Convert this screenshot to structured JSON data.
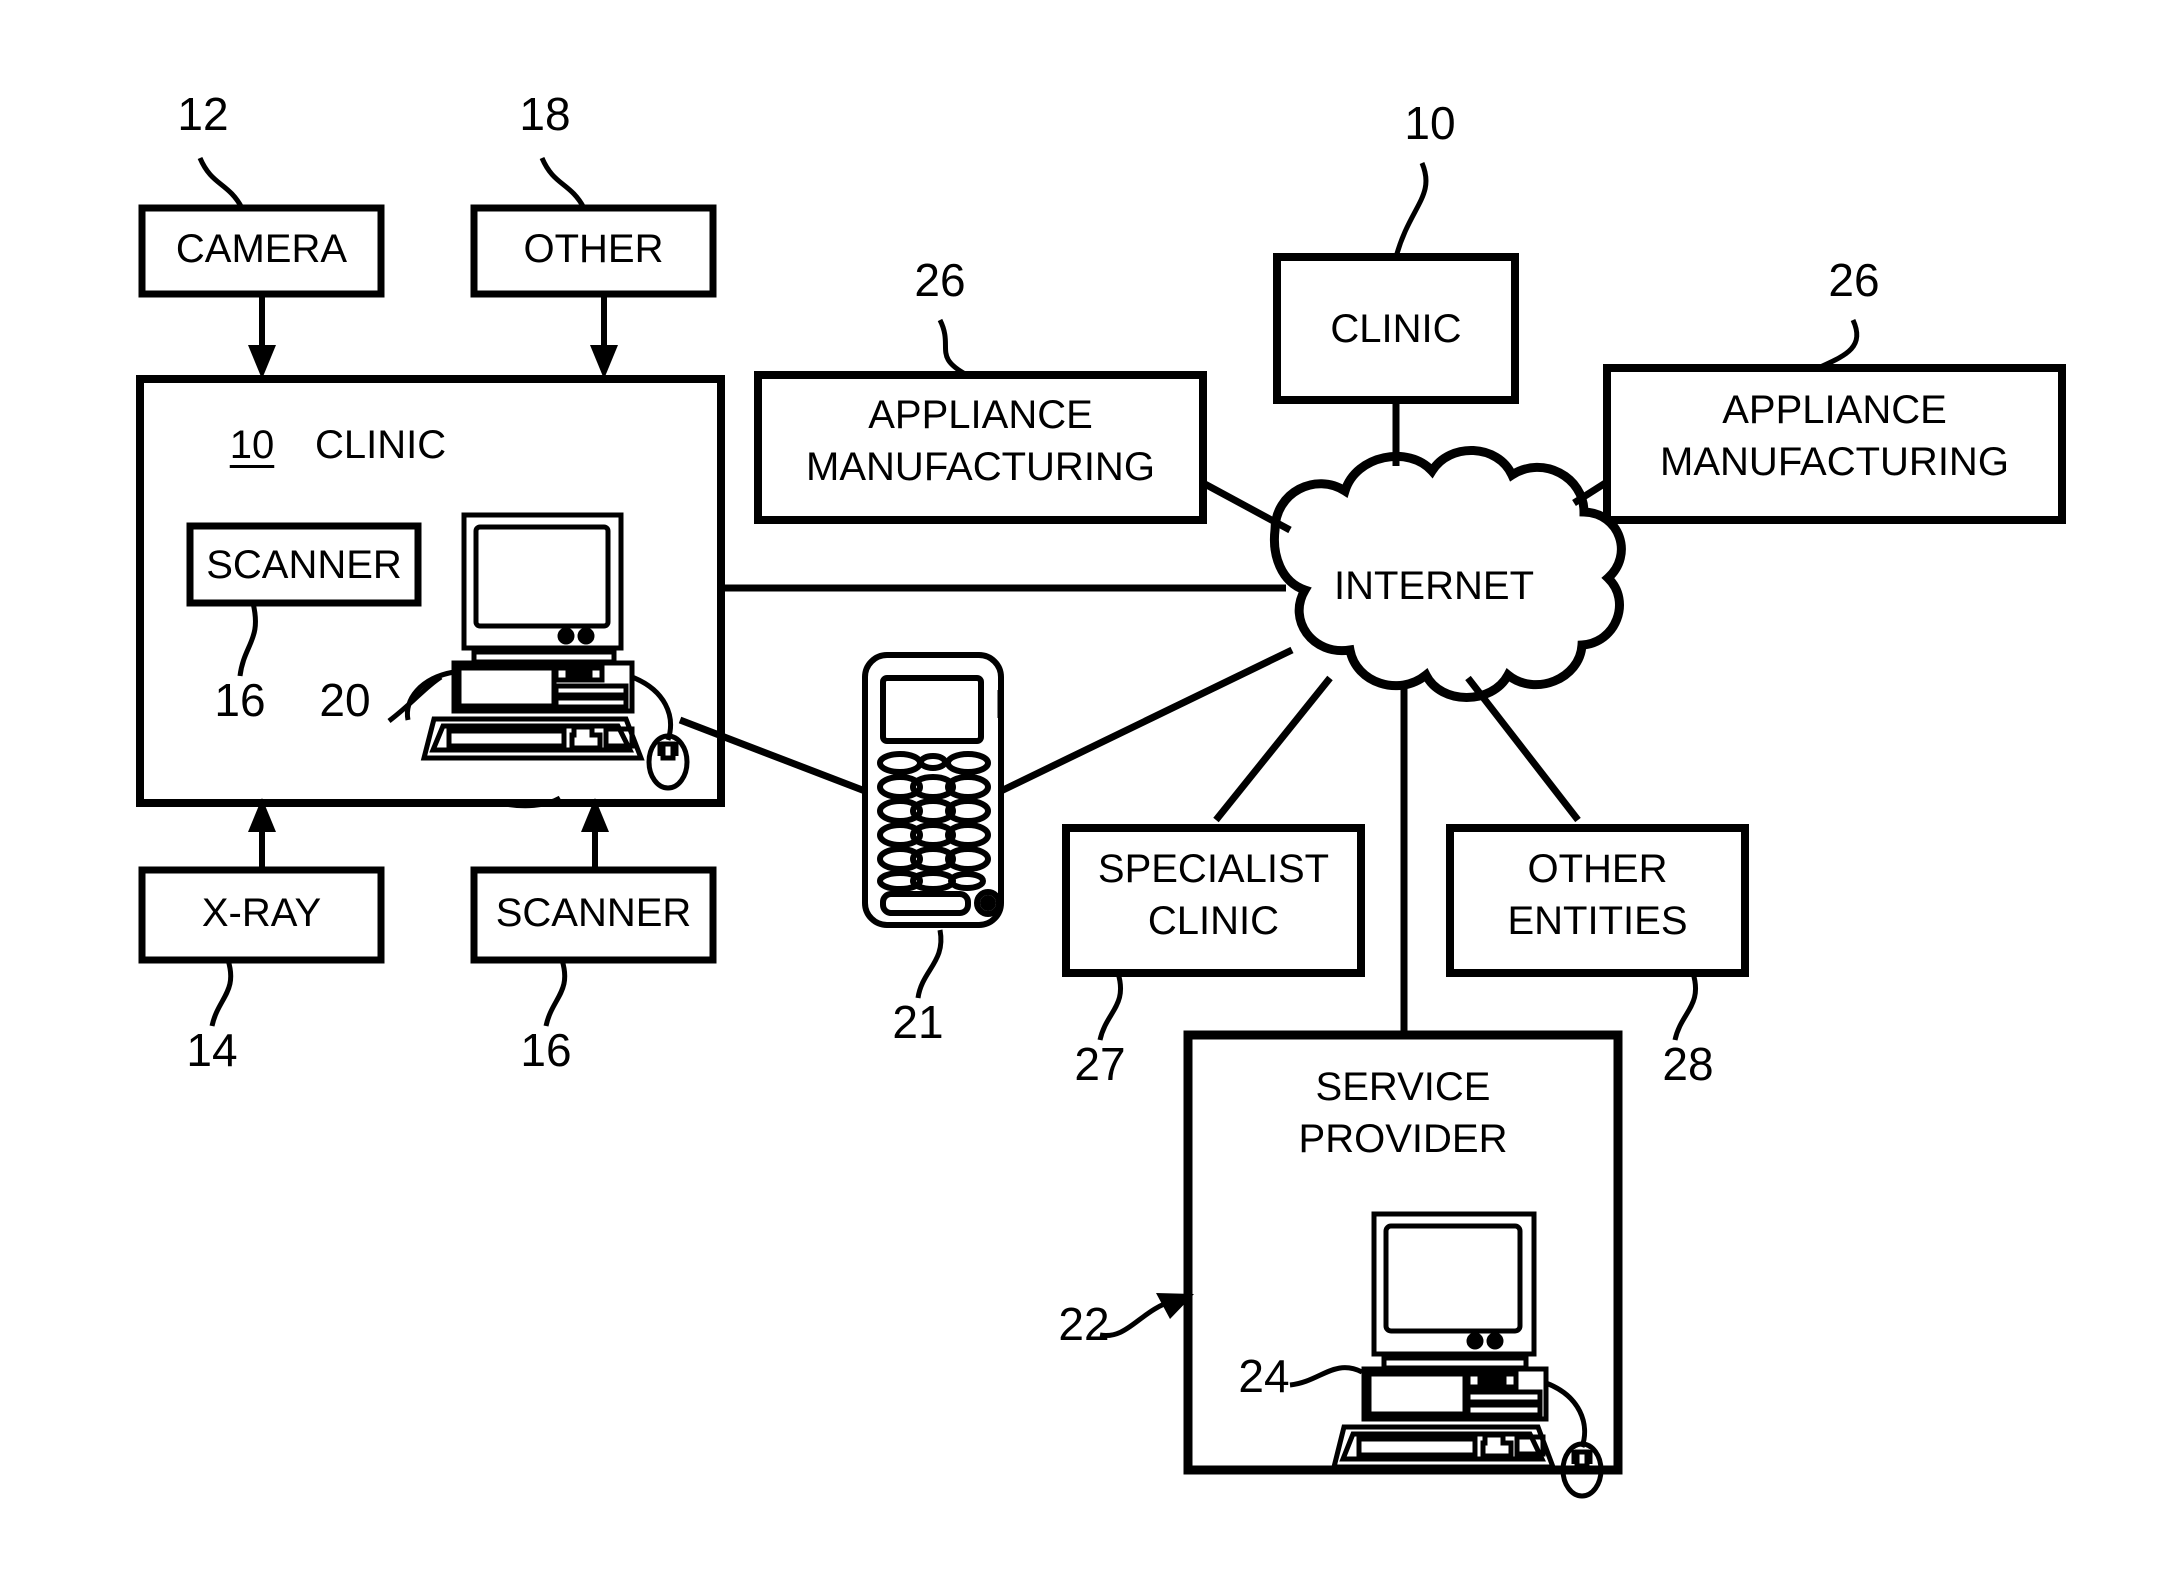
{
  "figure": {
    "type": "patent-block-diagram",
    "background": "#ffffff",
    "stroke": "#000000"
  },
  "boxes": {
    "camera": {
      "label": "CAMERA",
      "ref": "12"
    },
    "other": {
      "label": "OTHER",
      "ref": "18"
    },
    "clinic_local": {
      "label": "CLINIC",
      "ref": "10"
    },
    "scanner_inner": {
      "label": "SCANNER",
      "ref": "16"
    },
    "workstation": {
      "ref": "20"
    },
    "xray": {
      "label": "X-RAY",
      "ref": "14"
    },
    "scanner_bottom": {
      "label": "SCANNER",
      "ref": "16"
    },
    "mobile_device": {
      "ref": "21"
    },
    "appliance_manufacturing_left": {
      "line1": "APPLIANCE",
      "line2": "MANUFACTURING",
      "ref": "26"
    },
    "appliance_manufacturing_right": {
      "line1": "APPLIANCE",
      "line2": "MANUFACTURING",
      "ref": "26"
    },
    "clinic_remote": {
      "label": "CLINIC",
      "ref": "10"
    },
    "internet": {
      "label": "INTERNET"
    },
    "specialist_clinic": {
      "line1": "SPECIALIST",
      "line2": "CLINIC",
      "ref": "27"
    },
    "other_entities": {
      "line1": "OTHER",
      "line2": "ENTITIES",
      "ref": "28"
    },
    "service_provider": {
      "line1": "SERVICE",
      "line2": "PROVIDER",
      "ref": "22",
      "computer_ref": "24"
    }
  },
  "ref_numbers": [
    "12",
    "18",
    "10",
    "26",
    "26",
    "10",
    "16",
    "20",
    "14",
    "16",
    "21",
    "27",
    "28",
    "22",
    "24"
  ],
  "icons": {
    "workstation": "desktop-computer-icon",
    "service_provider_computer": "desktop-computer-icon",
    "mobile": "mobile-phone-icon",
    "internet": "cloud-icon"
  }
}
